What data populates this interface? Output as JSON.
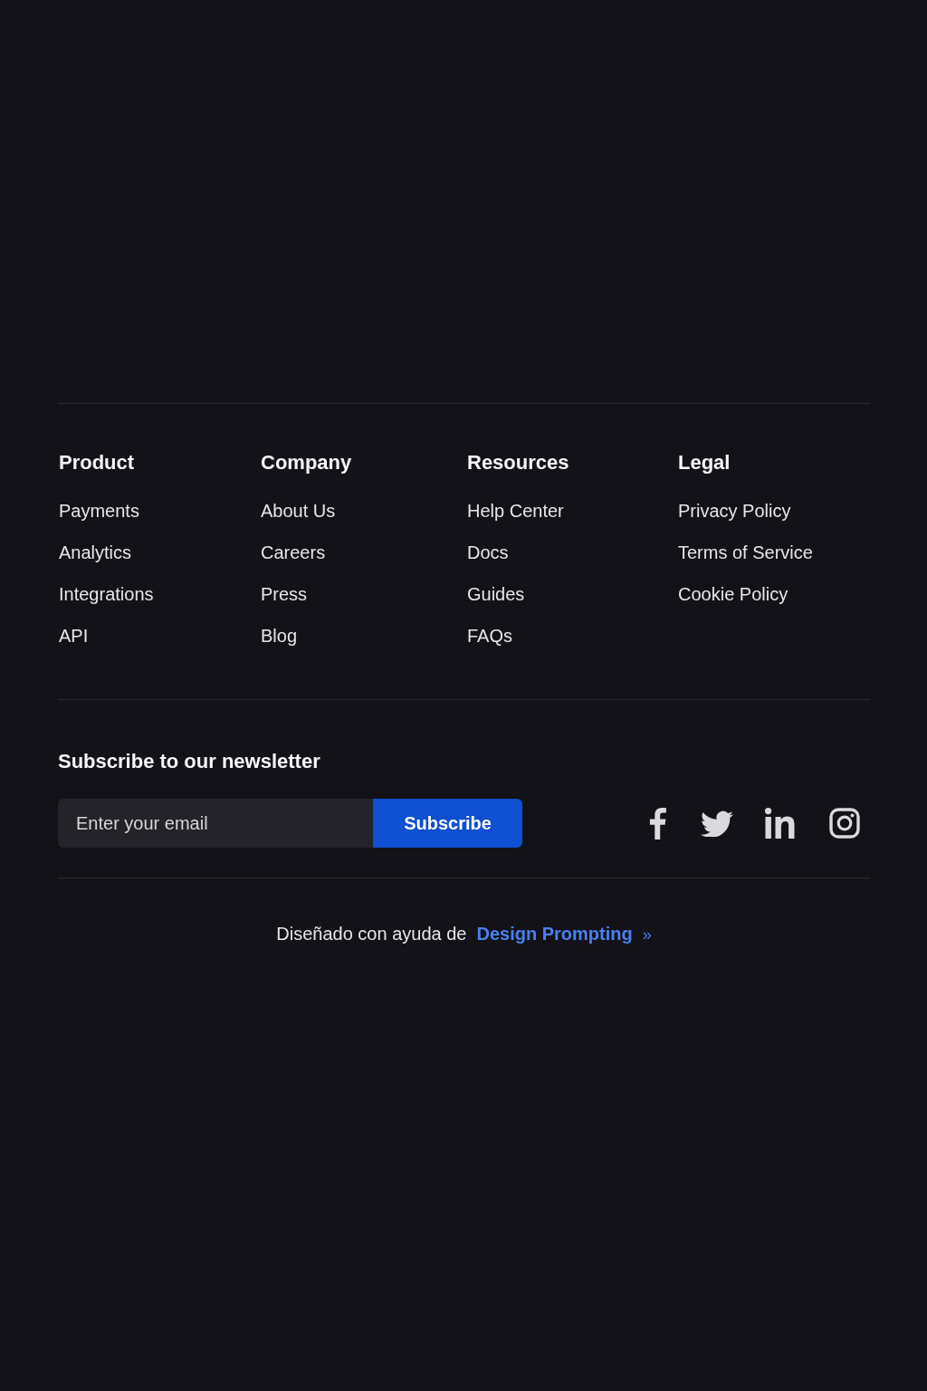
{
  "footer_columns": [
    {
      "heading": "Product",
      "links": [
        "Payments",
        "Analytics",
        "Integrations",
        "API"
      ]
    },
    {
      "heading": "Company",
      "links": [
        "About Us",
        "Careers",
        "Press",
        "Blog"
      ]
    },
    {
      "heading": "Resources",
      "links": [
        "Help Center",
        "Docs",
        "Guides",
        "FAQs"
      ]
    },
    {
      "heading": "Legal",
      "links": [
        "Privacy Policy",
        "Terms of Service",
        "Cookie Policy"
      ]
    }
  ],
  "newsletter": {
    "heading": "Subscribe to our newsletter",
    "email_field": {
      "placeholder": "Enter your email"
    },
    "button": "Subscribe"
  },
  "credit": {
    "text": "Diseñado con ayuda de",
    "link": "Design Prompting",
    "arrow": "»"
  }
}
